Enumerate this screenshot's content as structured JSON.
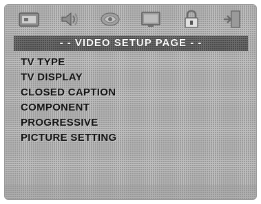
{
  "header": {
    "title": "- - VIDEO SETUP PAGE - -"
  },
  "icons": [
    {
      "name": "general-setup-icon",
      "label": ""
    },
    {
      "name": "audio-setup-icon",
      "label": ""
    },
    {
      "name": "dolby-setup-icon",
      "label": ""
    },
    {
      "name": "video-setup-icon",
      "label": ""
    },
    {
      "name": "lock-icon",
      "label": ""
    },
    {
      "name": "exit-icon",
      "label": ""
    }
  ],
  "menu": {
    "items": [
      {
        "label": "TV TYPE"
      },
      {
        "label": "TV DISPLAY"
      },
      {
        "label": "CLOSED CAPTION"
      },
      {
        "label": "COMPONENT"
      },
      {
        "label": "PROGRESSIVE"
      },
      {
        "label": "PICTURE SETTING"
      }
    ]
  }
}
